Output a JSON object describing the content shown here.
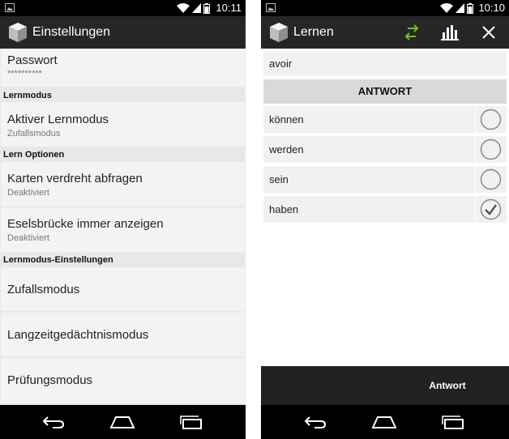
{
  "left": {
    "status": {
      "time": "10:11"
    },
    "action_bar": {
      "title": "Einstellungen",
      "icon": "app-box-icon"
    },
    "prefs": [
      {
        "title": "Passwort",
        "summary": "**********"
      },
      {
        "category": "Lernmodus"
      },
      {
        "title": "Aktiver Lernmodus",
        "summary": "Zufallsmodus"
      },
      {
        "category": "Lern Optionen"
      },
      {
        "title": "Karten verdreht abfragen",
        "summary": "Deaktiviert"
      },
      {
        "title": "Eselsbrücke immer anzeigen",
        "summary": "Deaktiviert"
      },
      {
        "category": "Lernmodus-Einstellungen"
      },
      {
        "title": "Zufallsmodus"
      },
      {
        "title": "Langzeitgedächtnismodus"
      },
      {
        "title": "Prüfungsmodus"
      }
    ]
  },
  "right": {
    "status": {
      "time": "10:10"
    },
    "action_bar": {
      "title": "Lernen",
      "icons": [
        "swap-arrows-icon",
        "statistics-icon",
        "close-icon"
      ],
      "swap_color": "#6fbf2a"
    },
    "question": "avoir",
    "answer_header": "ANTWORT",
    "options": [
      {
        "label": "können",
        "checked": false
      },
      {
        "label": "werden",
        "checked": false
      },
      {
        "label": "sein",
        "checked": false
      },
      {
        "label": "haben",
        "checked": true
      }
    ],
    "answer_button": "Antwort"
  },
  "colors": {
    "action_bar": "#262626",
    "status_bar": "#000000",
    "list_bg": "#e8e8e8",
    "item_bg": "#f3f3f3",
    "header_bg": "#d9d9d9"
  }
}
